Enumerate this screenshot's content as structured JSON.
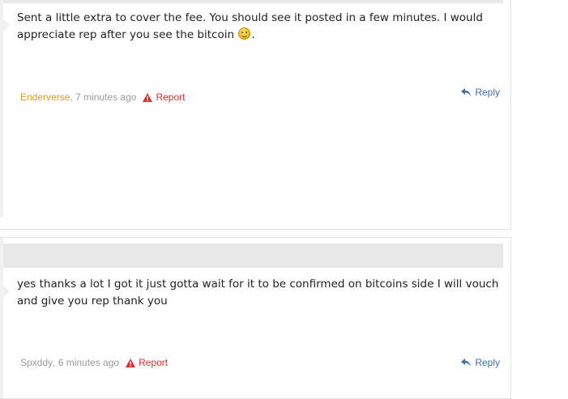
{
  "posts": [
    {
      "text_before_emoji": "Sent a little extra to cover the fee. You should see it posted in a few minutes. I would appreciate rep after you see the bitcoin",
      "emoji": "smile-emoji",
      "text_after_emoji": ".",
      "author": "Enderverse",
      "time": ", 7 minutes ago",
      "report_label": "Report",
      "reply_label": "Reply"
    },
    {
      "text": "yes thanks a lot I got it just gotta wait for it to be confirmed on bitcoins side I will vouch and give you rep thank you",
      "author": "Spxddy",
      "time": ", 6 minutes ago",
      "report_label": "Report",
      "reply_label": "Reply"
    }
  ],
  "colors": {
    "author_gold": "#d99a2b",
    "author_gray": "#9a9a9a",
    "report_red": "#e02b2b",
    "reply_blue": "#3f6fae",
    "bar_gray": "#e8e8e8"
  }
}
